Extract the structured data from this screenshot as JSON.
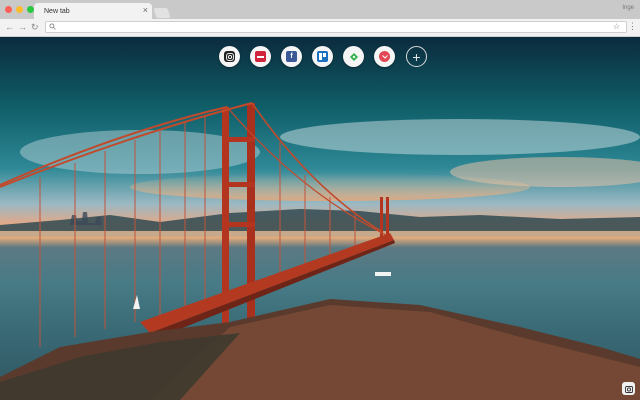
{
  "browser": {
    "tab_title": "New tab",
    "tab_close": "×",
    "profile_label": "Inge",
    "address_value": "",
    "address_placeholder": ""
  },
  "shortcuts": [
    {
      "name": "instagram",
      "icon": "instagram-icon",
      "color": "#222222"
    },
    {
      "name": "app-red",
      "icon": "app-red-icon",
      "color": "#d0253c"
    },
    {
      "name": "facebook",
      "icon": "facebook-icon",
      "color": "#3b5998"
    },
    {
      "name": "trello",
      "icon": "trello-icon",
      "color": "#1b6fc0"
    },
    {
      "name": "feedly",
      "icon": "feedly-icon",
      "color": "#2bb24c"
    },
    {
      "name": "pocket",
      "icon": "pocket-icon",
      "color": "#e34753"
    }
  ],
  "add_shortcut": "+",
  "colors": {
    "accent": "#1b6fc0"
  }
}
